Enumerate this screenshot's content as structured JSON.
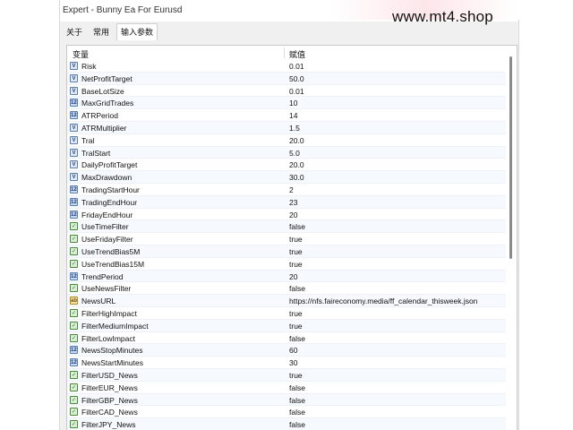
{
  "window": {
    "title": "Expert - Bunny Ea For Eurusd",
    "watermark": "www.mt4.shop"
  },
  "tabs": [
    {
      "label": "关于"
    },
    {
      "label": "常用"
    },
    {
      "label": "输入参数"
    }
  ],
  "table": {
    "col_variable": "变量",
    "col_value": "赋值",
    "rows": [
      {
        "type": "double",
        "icon": "double-icon",
        "badge": "V",
        "name": "Risk",
        "value": "0.01"
      },
      {
        "type": "double",
        "icon": "double-icon",
        "badge": "V",
        "name": "NetProfitTarget",
        "value": "50.0"
      },
      {
        "type": "double",
        "icon": "double-icon",
        "badge": "V",
        "name": "BaseLotSize",
        "value": "0.01"
      },
      {
        "type": "int",
        "icon": "int-icon",
        "badge": "123",
        "name": "MaxGridTrades",
        "value": "10"
      },
      {
        "type": "int",
        "icon": "int-icon",
        "badge": "123",
        "name": "ATRPeriod",
        "value": "14"
      },
      {
        "type": "double",
        "icon": "double-icon",
        "badge": "V",
        "name": "ATRMultiplier",
        "value": "1.5"
      },
      {
        "type": "double",
        "icon": "double-icon",
        "badge": "V",
        "name": "Tral",
        "value": "20.0"
      },
      {
        "type": "double",
        "icon": "double-icon",
        "badge": "V",
        "name": "TralStart",
        "value": "5.0"
      },
      {
        "type": "double",
        "icon": "double-icon",
        "badge": "V",
        "name": "DailyProfitTarget",
        "value": "20.0"
      },
      {
        "type": "double",
        "icon": "double-icon",
        "badge": "V",
        "name": "MaxDrawdown",
        "value": "30.0"
      },
      {
        "type": "int",
        "icon": "int-icon",
        "badge": "123",
        "name": "TradingStartHour",
        "value": "2"
      },
      {
        "type": "int",
        "icon": "int-icon",
        "badge": "123",
        "name": "TradingEndHour",
        "value": "23"
      },
      {
        "type": "int",
        "icon": "int-icon",
        "badge": "123",
        "name": "FridayEndHour",
        "value": "20"
      },
      {
        "type": "bool",
        "icon": "bool-icon",
        "badge": "✓",
        "name": "UseTimeFilter",
        "value": "false"
      },
      {
        "type": "bool",
        "icon": "bool-icon",
        "badge": "✓",
        "name": "UseFridayFilter",
        "value": "true"
      },
      {
        "type": "bool",
        "icon": "bool-icon",
        "badge": "✓",
        "name": "UseTrendBias5M",
        "value": "true"
      },
      {
        "type": "bool",
        "icon": "bool-icon",
        "badge": "✓",
        "name": "UseTrendBias15M",
        "value": "true"
      },
      {
        "type": "int",
        "icon": "int-icon",
        "badge": "123",
        "name": "TrendPeriod",
        "value": "20"
      },
      {
        "type": "bool",
        "icon": "bool-icon",
        "badge": "✓",
        "name": "UseNewsFilter",
        "value": "false"
      },
      {
        "type": "string",
        "icon": "string-icon",
        "badge": "ab",
        "name": "NewsURL",
        "value": "https://nfs.faireconomy.media/ff_calendar_thisweek.json"
      },
      {
        "type": "bool",
        "icon": "bool-icon",
        "badge": "✓",
        "name": "FilterHighImpact",
        "value": "true"
      },
      {
        "type": "bool",
        "icon": "bool-icon",
        "badge": "✓",
        "name": "FilterMediumImpact",
        "value": "true"
      },
      {
        "type": "bool",
        "icon": "bool-icon",
        "badge": "✓",
        "name": "FilterLowImpact",
        "value": "false"
      },
      {
        "type": "int",
        "icon": "int-icon",
        "badge": "123",
        "name": "NewsStopMinutes",
        "value": "60"
      },
      {
        "type": "int",
        "icon": "int-icon",
        "badge": "123",
        "name": "NewsStartMinutes",
        "value": "30"
      },
      {
        "type": "bool",
        "icon": "bool-icon",
        "badge": "✓",
        "name": "FilterUSD_News",
        "value": "true"
      },
      {
        "type": "bool",
        "icon": "bool-icon",
        "badge": "✓",
        "name": "FilterEUR_News",
        "value": "false"
      },
      {
        "type": "bool",
        "icon": "bool-icon",
        "badge": "✓",
        "name": "FilterGBP_News",
        "value": "false"
      },
      {
        "type": "bool",
        "icon": "bool-icon",
        "badge": "✓",
        "name": "FilterCAD_News",
        "value": "false"
      },
      {
        "type": "bool",
        "icon": "bool-icon",
        "badge": "✓",
        "name": "FilterJPY_News",
        "value": "false"
      }
    ]
  },
  "colors": {
    "panel_bg": "#ffffff",
    "row_alt": "#f6f9fd",
    "icon_double": "#dfe9f6",
    "icon_int": "#c8d8f0",
    "icon_bool": "#d7efd3",
    "icon_string": "#f4e2a8"
  }
}
